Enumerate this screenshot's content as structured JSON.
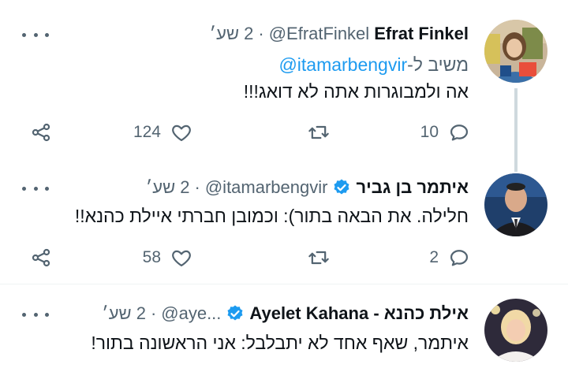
{
  "tweets": [
    {
      "name": "Efrat Finkel",
      "handle": "@EfratFinkel",
      "time": "2 שע׳",
      "sep": "·",
      "verified": false,
      "reply_prefix": "משיב ל-",
      "reply_handle": "@itamarbengvir",
      "text": "אה ולמבוגרות אתה לא דואג!!!",
      "replies": "10",
      "likes": "124"
    },
    {
      "name": "איתמר בן גביר",
      "handle": "@itamarbengvir",
      "time": "2 שע׳",
      "sep": "·",
      "verified": true,
      "text": "חלילה. את הבאה בתור): וכמובן חברתי איילת כהנא!!",
      "replies": "2",
      "likes": "58"
    },
    {
      "name": "אילת כהנא - Ayelet Kahana",
      "handle": "@aye...",
      "time": "2 שע׳",
      "sep": "·",
      "verified": true,
      "text": "איתמר, שאף אחד לא יתבלבל: אני הראשונה בתור!"
    }
  ],
  "colors": {
    "accent": "#1d9bf0",
    "secondary_text": "#536471",
    "thread_line": "#cfd9de"
  },
  "icons": [
    "reply-icon",
    "retweet-icon",
    "like-icon",
    "share-icon",
    "more-icon",
    "verified-badge-icon"
  ]
}
